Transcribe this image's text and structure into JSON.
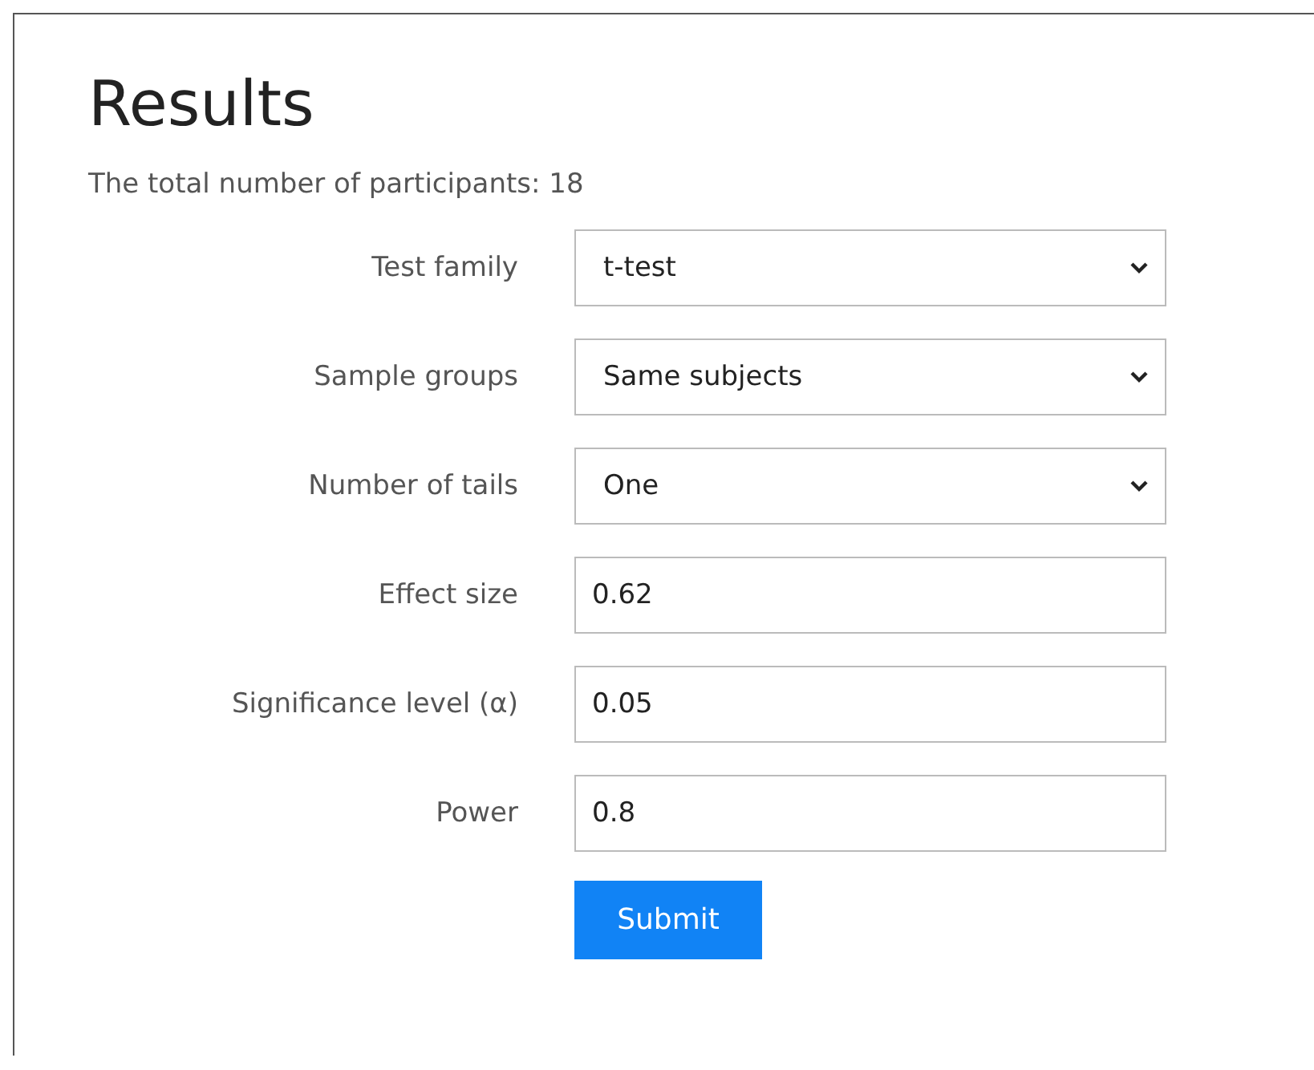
{
  "title": "Results",
  "summary": "The total number of participants: 18",
  "fields": [
    {
      "label": "Test family",
      "kind": "select",
      "value": "t-test"
    },
    {
      "label": "Sample groups",
      "kind": "select",
      "value": "Same subjects"
    },
    {
      "label": "Number of tails",
      "kind": "select",
      "value": "One"
    },
    {
      "label": "Effect size",
      "kind": "input",
      "value": "0.62"
    },
    {
      "label": "Significance level (α)",
      "kind": "input",
      "value": "0.05"
    },
    {
      "label": "Power",
      "kind": "input",
      "value": "0.8"
    }
  ],
  "submit": "Submit"
}
